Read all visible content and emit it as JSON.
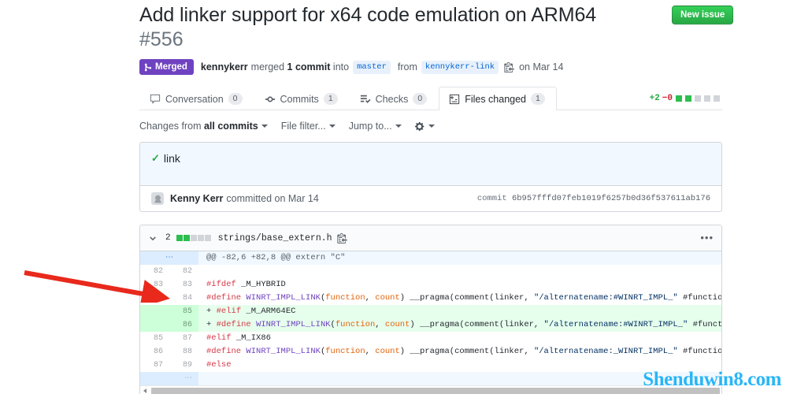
{
  "header": {
    "title": "Add linker support for x64 code emulation on ARM64",
    "number": "#556",
    "new_issue_label": "New issue",
    "state": "Merged",
    "author": "kennykerr",
    "merged_text": "merged",
    "commit_count_text": "1 commit",
    "into_text": "into",
    "base_branch": "master",
    "from_text": "from",
    "head_branch": "kennykerr-link",
    "date": "on Mar 14",
    "copy_icon": "copy-icon"
  },
  "tabs": [
    {
      "label": "Conversation",
      "count": "0",
      "icon": "comment-icon",
      "active": false
    },
    {
      "label": "Commits",
      "count": "1",
      "icon": "commit-icon",
      "active": false
    },
    {
      "label": "Checks",
      "count": "0",
      "icon": "checks-icon",
      "active": false
    },
    {
      "label": "Files changed",
      "count": "1",
      "icon": "file-diff-icon",
      "active": true
    }
  ],
  "diffstat": {
    "additions": "+2",
    "deletions": "−0",
    "green_blocks": 2,
    "gray_blocks": 3,
    "green_color": "#2cbe4e",
    "gray_color": "#d1d5da"
  },
  "toolbar": {
    "changes_from_prefix": "Changes from ",
    "changes_from_value": "all commits",
    "file_filter": "File filter...",
    "jump_to": "Jump to...",
    "gear_icon": "gear-icon"
  },
  "commit": {
    "message": "link",
    "status_icon": "check-icon",
    "author": "Kenny Kerr",
    "committed_text": "committed on Mar 14",
    "hash_label": "commit",
    "hash": "6b957fffd07feb1019f6257b0d36f537611ab176",
    "avatar_icon": "avatar-icon"
  },
  "file": {
    "name": "strings/base_extern.h",
    "change_count": "2",
    "green_blocks": 2,
    "gray_blocks": 3,
    "chevron_icon": "chevron-down-icon",
    "copy_path_icon": "copy-icon",
    "menu_icon": "kebab-menu-icon",
    "hunk_header": "@@ -82,6 +82,8 @@ extern \"C\"",
    "hunk_marker": "⋯"
  },
  "diff_lines": [
    {
      "type": "hunk",
      "old": "",
      "new": "",
      "text": "@@ -82,6 +82,8 @@ extern \"C\""
    },
    {
      "type": "context",
      "old": "82",
      "new": "82",
      "text": ""
    },
    {
      "type": "context",
      "old": "83",
      "new": "83",
      "text": "#ifdef _M_HYBRID"
    },
    {
      "type": "context",
      "old": "84",
      "new": "84",
      "text": "#define WINRT_IMPL_LINK(function, count) __pragma(comment(linker, \"/alternatename:#WINRT_IMPL_\" #function \"@\" #count \"=#\" #functi"
    },
    {
      "type": "add",
      "old": "",
      "new": "85",
      "text": "#elif _M_ARM64EC"
    },
    {
      "type": "add",
      "old": "",
      "new": "86",
      "text": "#define WINRT_IMPL_LINK(function, count) __pragma(comment(linker, \"/alternatename:#WINRT_IMPL_\" #function \"=#\" #function))"
    },
    {
      "type": "context",
      "old": "85",
      "new": "87",
      "text": "#elif _M_IX86"
    },
    {
      "type": "context",
      "old": "86",
      "new": "88",
      "text": "#define WINRT_IMPL_LINK(function, count) __pragma(comment(linker, \"/alternatename:_WINRT_IMPL_\" #function \"@\" #count \"=_\" #functi"
    },
    {
      "type": "context",
      "old": "87",
      "new": "89",
      "text": "#else"
    },
    {
      "type": "blank",
      "old": "",
      "new": "",
      "text": ""
    }
  ],
  "watermark": "Shenduwin8.com",
  "colors": {
    "merged_purple": "#6f42c1",
    "green_button": "#28a745",
    "link_blue": "#0366d6",
    "add_bg": "#e6ffed",
    "hunk_bg": "#f1f8ff"
  }
}
